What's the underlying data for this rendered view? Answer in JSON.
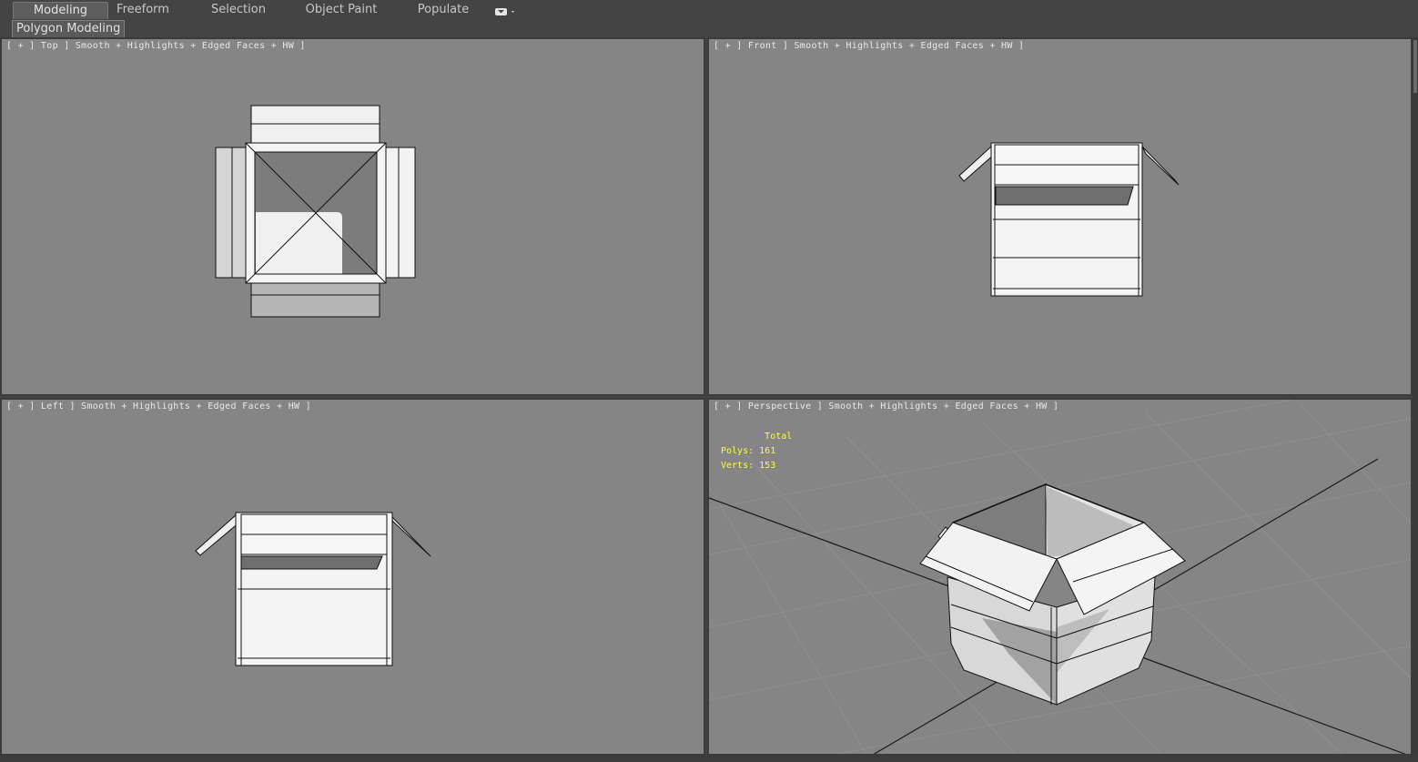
{
  "ribbon": {
    "tabs": [
      {
        "label": "Modeling",
        "active": true
      },
      {
        "label": "Freeform",
        "active": false
      },
      {
        "label": "Selection",
        "active": false
      },
      {
        "label": "Object Paint",
        "active": false
      },
      {
        "label": "Populate",
        "active": false
      }
    ],
    "extra_icon": "ribbon-options-icon",
    "panel_tab": "Polygon Modeling"
  },
  "viewports": {
    "top": {
      "label": "[ + ] Top ] Smooth + Highlights + Edged Faces + HW ]"
    },
    "front": {
      "label": "[ + ] Front ] Smooth + Highlights + Edged Faces + HW ]"
    },
    "left": {
      "label": "[ + ] Left ] Smooth + Highlights + Edged Faces + HW ]"
    },
    "perspective": {
      "label": "[ + ] Perspective ] Smooth + Highlights + Edged Faces + HW ]",
      "stats": {
        "header": "Total",
        "polys_label": "Polys:",
        "polys": "161",
        "verts_label": "Verts:",
        "verts": "153"
      }
    }
  },
  "colors": {
    "viewport_bg": "#858585",
    "stats_text": "#ffff33",
    "ui_bg": "#444444",
    "label_text": "#e8e8e8"
  }
}
